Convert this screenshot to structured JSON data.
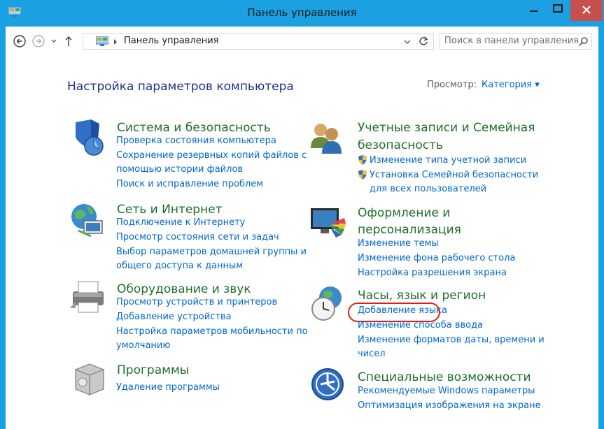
{
  "window": {
    "title": "Панель управления"
  },
  "nav": {
    "breadcrumb": "Панель управления",
    "search_placeholder": "Поиск в панели управления"
  },
  "header": {
    "heading": "Настройка параметров компьютера",
    "view_label": "Просмотр:",
    "view_value": "Категория ▾"
  },
  "categories": {
    "system": {
      "title": "Система и безопасность",
      "links": [
        "Проверка состояния компьютера",
        "Сохранение резервных копий файлов с",
        "помощью истории файлов",
        "Поиск и исправление проблем"
      ]
    },
    "network": {
      "title": "Сеть и Интернет",
      "links": [
        "Подключение к Интернету",
        "Просмотр состояния сети и задач",
        "Выбор параметров домашней группы и",
        "общего доступа к данным"
      ]
    },
    "hardware": {
      "title": "Оборудование и звук",
      "links": [
        "Просмотр устройств и принтеров",
        "Добавление устройства",
        "Настройка параметров мобильности по",
        "умолчанию"
      ]
    },
    "programs": {
      "title": "Программы",
      "links": [
        "Удаление программы"
      ]
    },
    "accounts": {
      "title_line1": "Учетные записи и Семейная",
      "title_line2": "безопасность",
      "links": [
        "Изменение типа учетной записи",
        "Установка Семейной безопасности",
        "для всех пользователей"
      ]
    },
    "appearance": {
      "title_line1": "Оформление и",
      "title_line2": "персонализация",
      "links": [
        "Изменение темы",
        "Изменение фона рабочего стола",
        "Настройка разрешения экрана"
      ]
    },
    "clock": {
      "title": "Часы, язык и регион",
      "links": [
        "Добавление языка",
        "Изменение способа ввода",
        "Изменение форматов даты, времени и",
        "чисел"
      ]
    },
    "ease": {
      "title": "Специальные возможности",
      "links": [
        "Рекомендуемые Windows параметры",
        "Оптимизация изображения на экране"
      ]
    }
  }
}
